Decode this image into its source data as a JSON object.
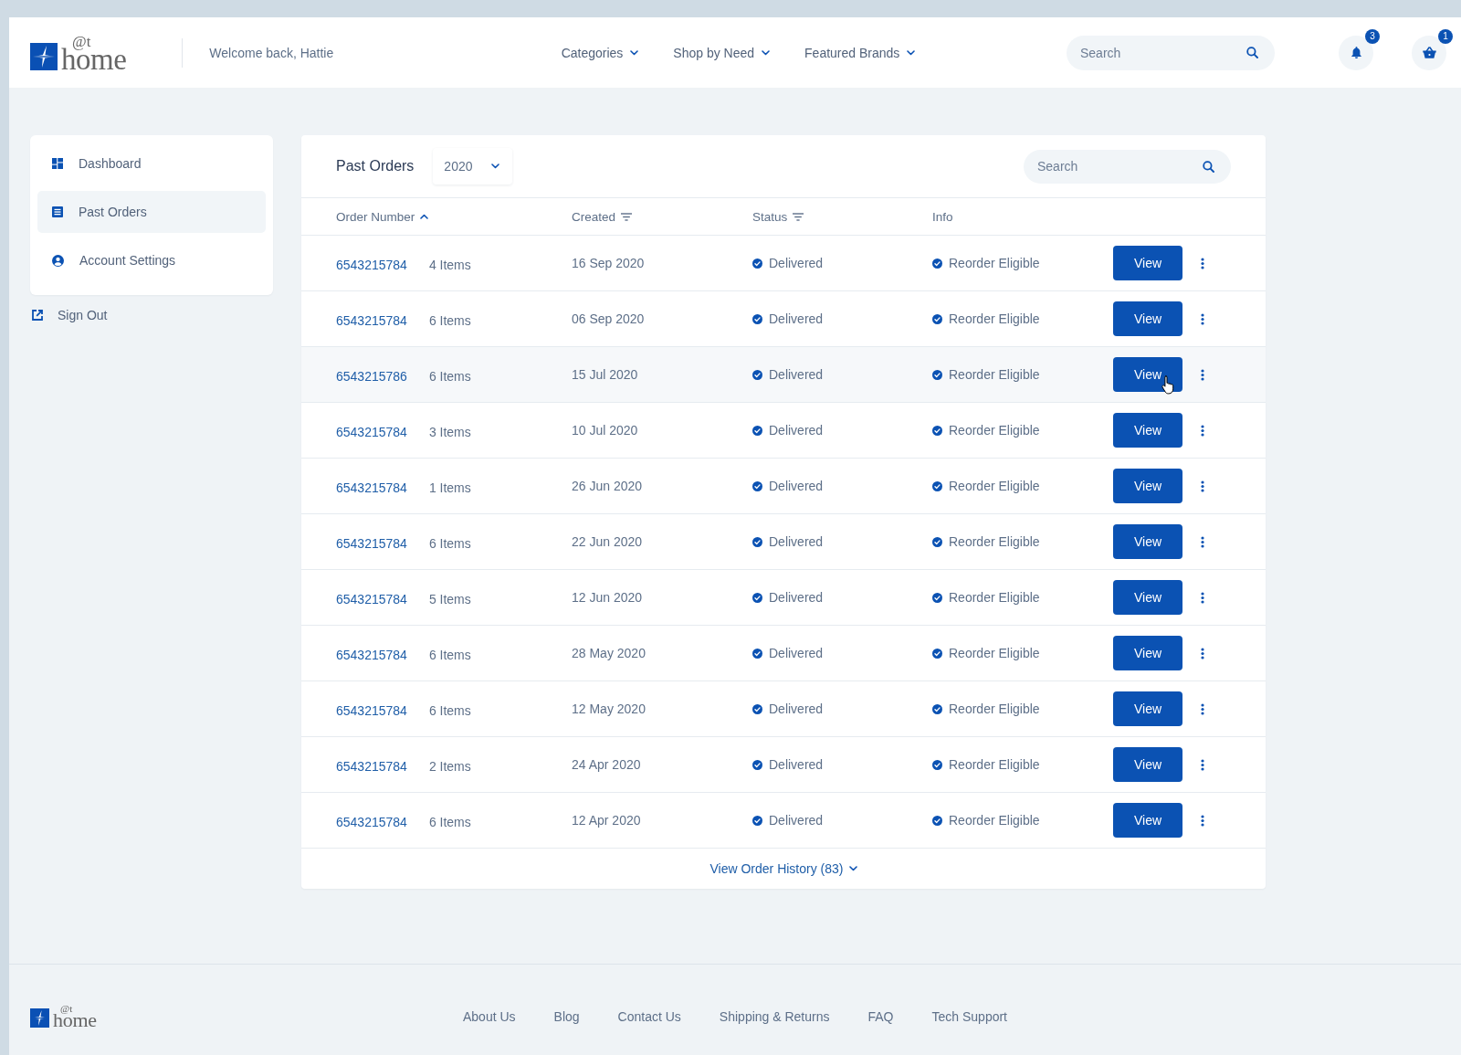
{
  "header": {
    "logo": {
      "at": "@t",
      "wordmark": "home"
    },
    "welcome": "Welcome back, Hattie",
    "nav": [
      "Categories",
      "Shop by Need",
      "Featured Brands"
    ],
    "search": {
      "placeholder": "Search"
    },
    "notifications": {
      "count": "3"
    },
    "cart": {
      "count": "1"
    }
  },
  "sidebar": {
    "items": [
      {
        "label": "Dashboard",
        "kind": "dashboard",
        "selected": false
      },
      {
        "label": "Past Orders",
        "kind": "orders",
        "selected": true
      },
      {
        "label": "Account Settings",
        "kind": "account",
        "selected": false
      }
    ],
    "sign_out": "Sign Out"
  },
  "orders_panel": {
    "title": "Past Orders",
    "year_filter": {
      "value": "2020"
    },
    "search": {
      "placeholder": "Search"
    },
    "columns": [
      {
        "label": "Order Number",
        "kind": "sort_ascending"
      },
      {
        "label": "Created",
        "kind": "filter"
      },
      {
        "label": "Status",
        "kind": "filter"
      },
      {
        "label": "Info",
        "kind": "plain"
      }
    ],
    "rows": [
      {
        "order_number": "6543215784",
        "items": "4 Items",
        "created": "16 Sep 2020",
        "status": "Delivered",
        "info": "Reorder Eligible",
        "action": "View",
        "hovered": false
      },
      {
        "order_number": "6543215784",
        "items": "6 Items",
        "created": "06 Sep 2020",
        "status": "Delivered",
        "info": "Reorder Eligible",
        "action": "View",
        "hovered": false
      },
      {
        "order_number": "6543215786",
        "items": "6 Items",
        "created": "15 Jul 2020",
        "status": "Delivered",
        "info": "Reorder Eligible",
        "action": "View",
        "hovered": true
      },
      {
        "order_number": "6543215784",
        "items": "3 Items",
        "created": "10 Jul 2020",
        "status": "Delivered",
        "info": "Reorder Eligible",
        "action": "View",
        "hovered": false
      },
      {
        "order_number": "6543215784",
        "items": "1 Items",
        "created": "26 Jun 2020",
        "status": "Delivered",
        "info": "Reorder Eligible",
        "action": "View",
        "hovered": false
      },
      {
        "order_number": "6543215784",
        "items": "6 Items",
        "created": "22 Jun 2020",
        "status": "Delivered",
        "info": "Reorder Eligible",
        "action": "View",
        "hovered": false
      },
      {
        "order_number": "6543215784",
        "items": "5 Items",
        "created": "12 Jun 2020",
        "status": "Delivered",
        "info": "Reorder Eligible",
        "action": "View",
        "hovered": false
      },
      {
        "order_number": "6543215784",
        "items": "6 Items",
        "created": "28 May 2020",
        "status": "Delivered",
        "info": "Reorder Eligible",
        "action": "View",
        "hovered": false
      },
      {
        "order_number": "6543215784",
        "items": "6 Items",
        "created": "12 May 2020",
        "status": "Delivered",
        "info": "Reorder Eligible",
        "action": "View",
        "hovered": false
      },
      {
        "order_number": "6543215784",
        "items": "2 Items",
        "created": "24 Apr 2020",
        "status": "Delivered",
        "info": "Reorder Eligible",
        "action": "View",
        "hovered": false
      },
      {
        "order_number": "6543215784",
        "items": "6 Items",
        "created": "12 Apr 2020",
        "status": "Delivered",
        "info": "Reorder Eligible",
        "action": "View",
        "hovered": false
      }
    ],
    "history_link": "View Order History (83)"
  },
  "footer": {
    "logo": {
      "at": "@t",
      "wordmark": "home"
    },
    "links": [
      "About Us",
      "Blog",
      "Contact Us",
      "Shipping & Returns",
      "FAQ",
      "Tech Support"
    ]
  }
}
